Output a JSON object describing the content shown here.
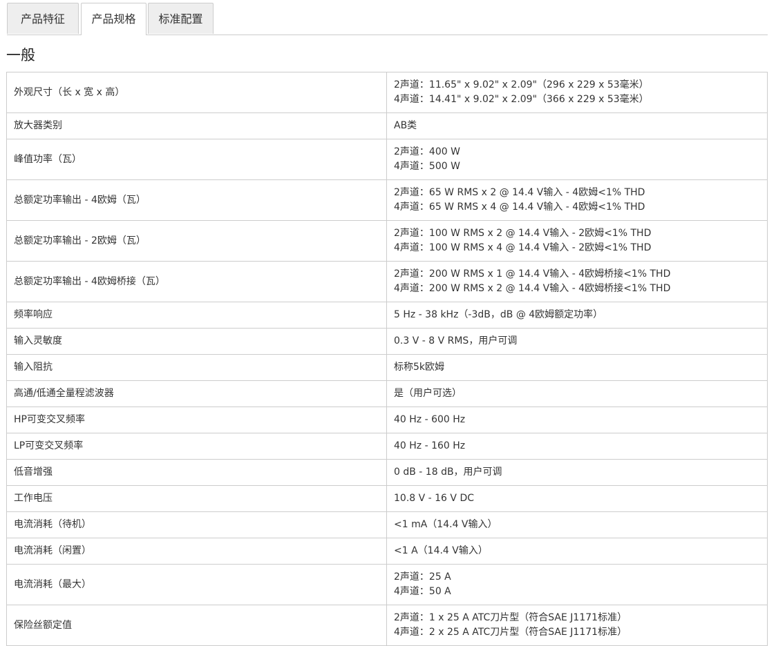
{
  "tabs": [
    {
      "label": "产品特征",
      "active": false
    },
    {
      "label": "产品规格",
      "active": true
    },
    {
      "label": "标准配置",
      "active": false
    }
  ],
  "section": {
    "title": "一般"
  },
  "specs": [
    {
      "label": "外观尺寸（长 x 宽 x 高）",
      "values": [
        "2声道：11.65\" x 9.02\" x 2.09\"（296 x 229 x 53毫米）",
        "4声道：14.41\" x 9.02\" x 2.09\"（366 x 229 x 53毫米）"
      ]
    },
    {
      "label": "放大器类别",
      "values": [
        "AB类"
      ]
    },
    {
      "label": "峰值功率（瓦）",
      "values": [
        "2声道：400 W",
        "4声道：500 W"
      ]
    },
    {
      "label": "总额定功率输出 - 4欧姆（瓦）",
      "values": [
        "2声道：65 W RMS x 2 @ 14.4 V输入 - 4欧姆<1% THD",
        "4声道：65 W RMS x 4 @ 14.4 V输入 - 4欧姆<1% THD"
      ]
    },
    {
      "label": "总额定功率输出 - 2欧姆（瓦）",
      "values": [
        "2声道：100 W RMS x 2 @ 14.4 V输入 - 2欧姆<1% THD",
        "4声道：100 W RMS x 4 @ 14.4 V输入 - 2欧姆<1% THD"
      ]
    },
    {
      "label": "总额定功率输出 - 4欧姆桥接（瓦）",
      "values": [
        "2声道：200 W RMS x 1 @ 14.4 V输入 - 4欧姆桥接<1% THD",
        "4声道：200 W RMS x 2 @ 14.4 V输入 - 4欧姆桥接<1% THD"
      ]
    },
    {
      "label": "频率响应",
      "values": [
        "5 Hz - 38 kHz（-3dB，dB @ 4欧姆额定功率）"
      ]
    },
    {
      "label": "输入灵敏度",
      "values": [
        "0.3 V - 8 V RMS，用户可调"
      ]
    },
    {
      "label": "输入阻抗",
      "values": [
        "标称5k欧姆"
      ]
    },
    {
      "label": "高通/低通全量程滤波器",
      "values": [
        "是（用户可选）"
      ]
    },
    {
      "label": "HP可变交叉频率",
      "values": [
        "40 Hz - 600 Hz"
      ]
    },
    {
      "label": "LP可变交叉频率",
      "values": [
        "40 Hz - 160 Hz"
      ]
    },
    {
      "label": "低音增强",
      "values": [
        "0 dB - 18 dB，用户可调"
      ]
    },
    {
      "label": "工作电压",
      "values": [
        "10.8 V - 16 V DC"
      ]
    },
    {
      "label": "电流消耗（待机）",
      "values": [
        "<1 mA（14.4 V输入）"
      ]
    },
    {
      "label": "电流消耗（闲置）",
      "values": [
        "<1 A（14.4 V输入）"
      ]
    },
    {
      "label": "电流消耗（最大）",
      "values": [
        "2声道：25 A",
        "4声道：50 A"
      ]
    },
    {
      "label": "保险丝额定值",
      "values": [
        "2声道：1 x 25 A ATC刀片型（符合SAE J1171标准）",
        "4声道：2 x 25 A ATC刀片型（符合SAE J1171标准）"
      ]
    }
  ]
}
